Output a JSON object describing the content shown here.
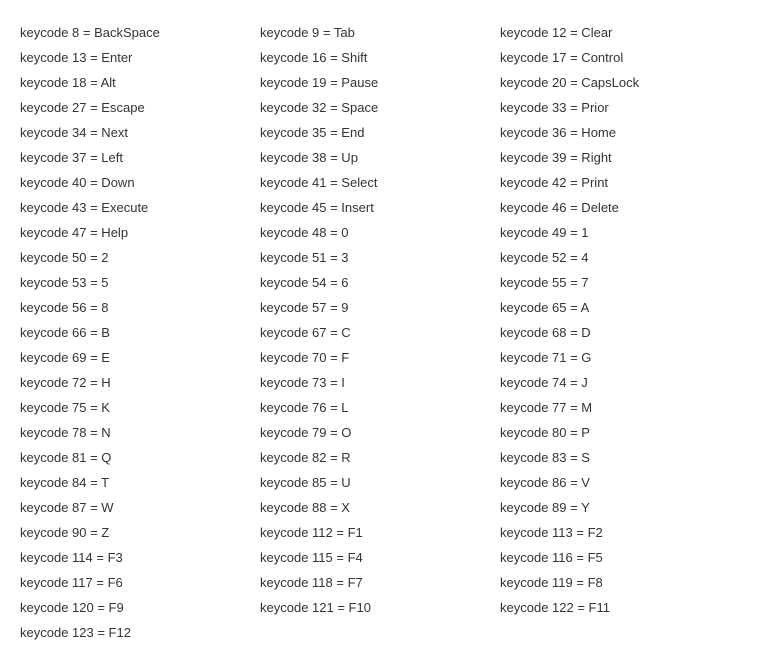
{
  "entries": [
    {
      "code": 8,
      "name": "BackSpace"
    },
    {
      "code": 9,
      "name": "Tab"
    },
    {
      "code": 12,
      "name": "Clear"
    },
    {
      "code": 13,
      "name": "Enter"
    },
    {
      "code": 16,
      "name": "Shift"
    },
    {
      "code": 17,
      "name": "Control"
    },
    {
      "code": 18,
      "name": "Alt"
    },
    {
      "code": 19,
      "name": "Pause"
    },
    {
      "code": 20,
      "name": "CapsLock"
    },
    {
      "code": 27,
      "name": "Escape"
    },
    {
      "code": 32,
      "name": "Space"
    },
    {
      "code": 33,
      "name": "Prior"
    },
    {
      "code": 34,
      "name": "Next"
    },
    {
      "code": 35,
      "name": "End"
    },
    {
      "code": 36,
      "name": "Home"
    },
    {
      "code": 37,
      "name": "Left"
    },
    {
      "code": 38,
      "name": "Up"
    },
    {
      "code": 39,
      "name": "Right"
    },
    {
      "code": 40,
      "name": "Down"
    },
    {
      "code": 41,
      "name": "Select"
    },
    {
      "code": 42,
      "name": "Print"
    },
    {
      "code": 43,
      "name": "Execute"
    },
    {
      "code": 45,
      "name": "Insert"
    },
    {
      "code": 46,
      "name": "Delete"
    },
    {
      "code": 47,
      "name": "Help"
    },
    {
      "code": 48,
      "name": "0"
    },
    {
      "code": 49,
      "name": "1"
    },
    {
      "code": 50,
      "name": "2"
    },
    {
      "code": 51,
      "name": "3"
    },
    {
      "code": 52,
      "name": "4"
    },
    {
      "code": 53,
      "name": "5"
    },
    {
      "code": 54,
      "name": "6"
    },
    {
      "code": 55,
      "name": "7"
    },
    {
      "code": 56,
      "name": "8"
    },
    {
      "code": 57,
      "name": "9"
    },
    {
      "code": 65,
      "name": "A"
    },
    {
      "code": 66,
      "name": "B"
    },
    {
      "code": 67,
      "name": "C"
    },
    {
      "code": 68,
      "name": "D"
    },
    {
      "code": 69,
      "name": "E"
    },
    {
      "code": 70,
      "name": "F"
    },
    {
      "code": 71,
      "name": "G"
    },
    {
      "code": 72,
      "name": "H"
    },
    {
      "code": 73,
      "name": "I"
    },
    {
      "code": 74,
      "name": "J"
    },
    {
      "code": 75,
      "name": "K"
    },
    {
      "code": 76,
      "name": "L"
    },
    {
      "code": 77,
      "name": "M"
    },
    {
      "code": 78,
      "name": "N"
    },
    {
      "code": 79,
      "name": "O"
    },
    {
      "code": 80,
      "name": "P"
    },
    {
      "code": 81,
      "name": "Q"
    },
    {
      "code": 82,
      "name": "R"
    },
    {
      "code": 83,
      "name": "S"
    },
    {
      "code": 84,
      "name": "T"
    },
    {
      "code": 85,
      "name": "U"
    },
    {
      "code": 86,
      "name": "V"
    },
    {
      "code": 87,
      "name": "W"
    },
    {
      "code": 88,
      "name": "X"
    },
    {
      "code": 89,
      "name": "Y"
    },
    {
      "code": 90,
      "name": "Z"
    },
    {
      "code": 112,
      "name": "F1"
    },
    {
      "code": 113,
      "name": "F2"
    },
    {
      "code": 114,
      "name": "F3"
    },
    {
      "code": 115,
      "name": "F4"
    },
    {
      "code": 116,
      "name": "F5"
    },
    {
      "code": 117,
      "name": "F6"
    },
    {
      "code": 118,
      "name": "F7"
    },
    {
      "code": 119,
      "name": "F8"
    },
    {
      "code": 120,
      "name": "F9"
    },
    {
      "code": 121,
      "name": "F10"
    },
    {
      "code": 122,
      "name": "F11"
    },
    {
      "code": 123,
      "name": "F12"
    }
  ]
}
